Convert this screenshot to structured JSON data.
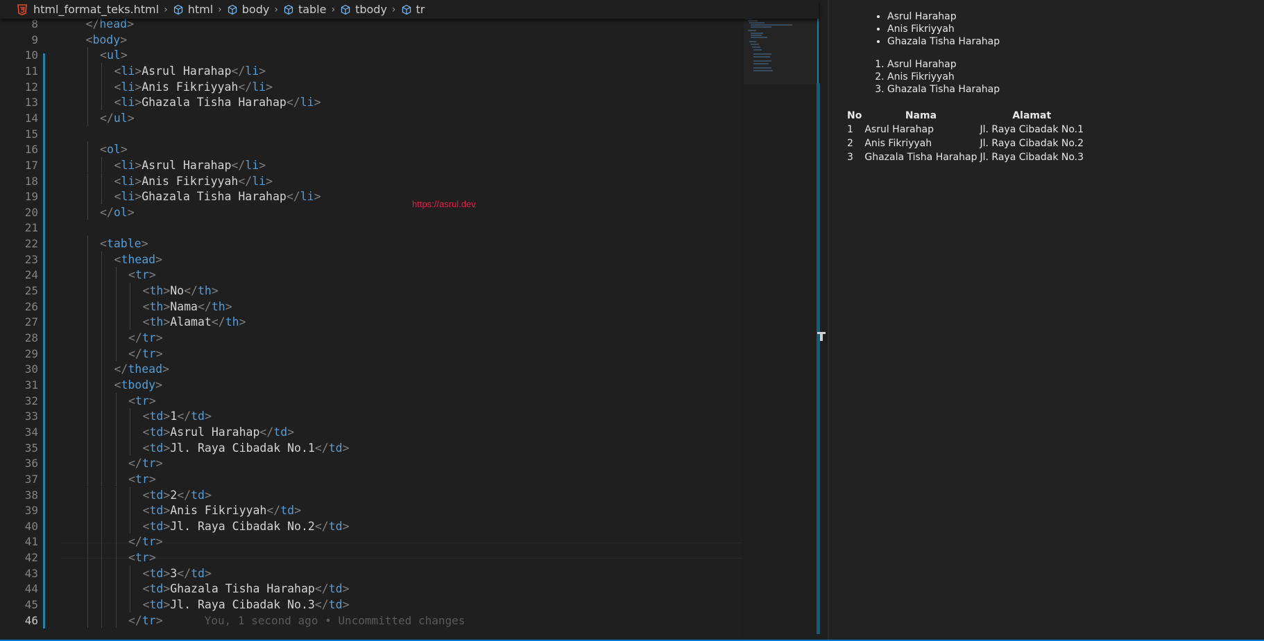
{
  "breadcrumb": {
    "file": "html_format_teks.html",
    "path": [
      "html",
      "body",
      "table",
      "tbody",
      "tr"
    ]
  },
  "editor": {
    "current_line": "46",
    "blame": "You, 1 second ago • Uncommitted changes",
    "lines": [
      {
        "n": "8",
        "indent": 1,
        "parts": [
          [
            "br",
            "</"
          ],
          [
            "tg",
            "head"
          ],
          [
            "br",
            ">"
          ]
        ]
      },
      {
        "n": "9",
        "indent": 1,
        "parts": [
          [
            "br",
            "<"
          ],
          [
            "tg",
            "body"
          ],
          [
            "br",
            ">"
          ]
        ]
      },
      {
        "n": "10",
        "indent": 2,
        "parts": [
          [
            "br",
            "<"
          ],
          [
            "tg",
            "ul"
          ],
          [
            "br",
            ">"
          ]
        ]
      },
      {
        "n": "11",
        "indent": 3,
        "parts": [
          [
            "br",
            "<"
          ],
          [
            "tg",
            "li"
          ],
          [
            "br",
            ">"
          ],
          [
            "tx",
            "Asrul Harahap"
          ],
          [
            "br",
            "</"
          ],
          [
            "tg",
            "li"
          ],
          [
            "br",
            ">"
          ]
        ]
      },
      {
        "n": "12",
        "indent": 3,
        "parts": [
          [
            "br",
            "<"
          ],
          [
            "tg",
            "li"
          ],
          [
            "br",
            ">"
          ],
          [
            "tx",
            "Anis Fikriyyah"
          ],
          [
            "br",
            "</"
          ],
          [
            "tg",
            "li"
          ],
          [
            "br",
            ">"
          ]
        ]
      },
      {
        "n": "13",
        "indent": 3,
        "parts": [
          [
            "br",
            "<"
          ],
          [
            "tg",
            "li"
          ],
          [
            "br",
            ">"
          ],
          [
            "tx",
            "Ghazala Tisha Harahap"
          ],
          [
            "br",
            "</"
          ],
          [
            "tg",
            "li"
          ],
          [
            "br",
            ">"
          ]
        ]
      },
      {
        "n": "14",
        "indent": 2,
        "parts": [
          [
            "br",
            "</"
          ],
          [
            "tg",
            "ul"
          ],
          [
            "br",
            ">"
          ]
        ]
      },
      {
        "n": "15",
        "indent": 0,
        "parts": []
      },
      {
        "n": "16",
        "indent": 2,
        "parts": [
          [
            "br",
            "<"
          ],
          [
            "tg",
            "ol"
          ],
          [
            "br",
            ">"
          ]
        ]
      },
      {
        "n": "17",
        "indent": 3,
        "parts": [
          [
            "br",
            "<"
          ],
          [
            "tg",
            "li"
          ],
          [
            "br",
            ">"
          ],
          [
            "tx",
            "Asrul Harahap"
          ],
          [
            "br",
            "</"
          ],
          [
            "tg",
            "li"
          ],
          [
            "br",
            ">"
          ]
        ]
      },
      {
        "n": "18",
        "indent": 3,
        "parts": [
          [
            "br",
            "<"
          ],
          [
            "tg",
            "li"
          ],
          [
            "br",
            ">"
          ],
          [
            "tx",
            "Anis Fikriyyah"
          ],
          [
            "br",
            "</"
          ],
          [
            "tg",
            "li"
          ],
          [
            "br",
            ">"
          ]
        ]
      },
      {
        "n": "19",
        "indent": 3,
        "parts": [
          [
            "br",
            "<"
          ],
          [
            "tg",
            "li"
          ],
          [
            "br",
            ">"
          ],
          [
            "tx",
            "Ghazala Tisha Harahap"
          ],
          [
            "br",
            "</"
          ],
          [
            "tg",
            "li"
          ],
          [
            "br",
            ">"
          ]
        ]
      },
      {
        "n": "20",
        "indent": 2,
        "parts": [
          [
            "br",
            "</"
          ],
          [
            "tg",
            "ol"
          ],
          [
            "br",
            ">"
          ]
        ]
      },
      {
        "n": "21",
        "indent": 0,
        "parts": []
      },
      {
        "n": "22",
        "indent": 2,
        "parts": [
          [
            "br",
            "<"
          ],
          [
            "tg",
            "table"
          ],
          [
            "br",
            ">"
          ]
        ]
      },
      {
        "n": "23",
        "indent": 3,
        "parts": [
          [
            "br",
            "<"
          ],
          [
            "tg",
            "thead"
          ],
          [
            "br",
            ">"
          ]
        ]
      },
      {
        "n": "24",
        "indent": 4,
        "parts": [
          [
            "br",
            "<"
          ],
          [
            "tg",
            "tr"
          ],
          [
            "br",
            ">"
          ]
        ]
      },
      {
        "n": "25",
        "indent": 5,
        "parts": [
          [
            "br",
            "<"
          ],
          [
            "tg",
            "th"
          ],
          [
            "br",
            ">"
          ],
          [
            "tx",
            "No"
          ],
          [
            "br",
            "</"
          ],
          [
            "tg",
            "th"
          ],
          [
            "br",
            ">"
          ]
        ]
      },
      {
        "n": "26",
        "indent": 5,
        "parts": [
          [
            "br",
            "<"
          ],
          [
            "tg",
            "th"
          ],
          [
            "br",
            ">"
          ],
          [
            "tx",
            "Nama"
          ],
          [
            "br",
            "</"
          ],
          [
            "tg",
            "th"
          ],
          [
            "br",
            ">"
          ]
        ]
      },
      {
        "n": "27",
        "indent": 5,
        "parts": [
          [
            "br",
            "<"
          ],
          [
            "tg",
            "th"
          ],
          [
            "br",
            ">"
          ],
          [
            "tx",
            "Alamat"
          ],
          [
            "br",
            "</"
          ],
          [
            "tg",
            "th"
          ],
          [
            "br",
            ">"
          ]
        ]
      },
      {
        "n": "28",
        "indent": 4,
        "parts": [
          [
            "br",
            "</"
          ],
          [
            "tg",
            "tr"
          ],
          [
            "br",
            ">"
          ]
        ]
      },
      {
        "n": "29",
        "indent": 4,
        "parts": [
          [
            "br",
            "</"
          ],
          [
            "tg",
            "tr"
          ],
          [
            "br",
            ">"
          ]
        ]
      },
      {
        "n": "30",
        "indent": 3,
        "parts": [
          [
            "br",
            "</"
          ],
          [
            "tg",
            "thead"
          ],
          [
            "br",
            ">"
          ]
        ]
      },
      {
        "n": "31",
        "indent": 3,
        "parts": [
          [
            "br",
            "<"
          ],
          [
            "tg",
            "tbody"
          ],
          [
            "br",
            ">"
          ]
        ]
      },
      {
        "n": "32",
        "indent": 4,
        "parts": [
          [
            "br",
            "<"
          ],
          [
            "tg",
            "tr"
          ],
          [
            "br",
            ">"
          ]
        ]
      },
      {
        "n": "33",
        "indent": 5,
        "parts": [
          [
            "br",
            "<"
          ],
          [
            "tg",
            "td"
          ],
          [
            "br",
            ">"
          ],
          [
            "tx",
            "1"
          ],
          [
            "br",
            "</"
          ],
          [
            "tg",
            "td"
          ],
          [
            "br",
            ">"
          ]
        ]
      },
      {
        "n": "34",
        "indent": 5,
        "parts": [
          [
            "br",
            "<"
          ],
          [
            "tg",
            "td"
          ],
          [
            "br",
            ">"
          ],
          [
            "tx",
            "Asrul Harahap"
          ],
          [
            "br",
            "</"
          ],
          [
            "tg",
            "td"
          ],
          [
            "br",
            ">"
          ]
        ]
      },
      {
        "n": "35",
        "indent": 5,
        "parts": [
          [
            "br",
            "<"
          ],
          [
            "tg",
            "td"
          ],
          [
            "br",
            ">"
          ],
          [
            "tx",
            "Jl. Raya Cibadak No.1"
          ],
          [
            "br",
            "</"
          ],
          [
            "tg",
            "td"
          ],
          [
            "br",
            ">"
          ]
        ]
      },
      {
        "n": "36",
        "indent": 4,
        "parts": [
          [
            "br",
            "</"
          ],
          [
            "tg",
            "tr"
          ],
          [
            "br",
            ">"
          ]
        ]
      },
      {
        "n": "37",
        "indent": 4,
        "parts": [
          [
            "br",
            "<"
          ],
          [
            "tg",
            "tr"
          ],
          [
            "br",
            ">"
          ]
        ]
      },
      {
        "n": "38",
        "indent": 5,
        "parts": [
          [
            "br",
            "<"
          ],
          [
            "tg",
            "td"
          ],
          [
            "br",
            ">"
          ],
          [
            "tx",
            "2"
          ],
          [
            "br",
            "</"
          ],
          [
            "tg",
            "td"
          ],
          [
            "br",
            ">"
          ]
        ]
      },
      {
        "n": "39",
        "indent": 5,
        "parts": [
          [
            "br",
            "<"
          ],
          [
            "tg",
            "td"
          ],
          [
            "br",
            ">"
          ],
          [
            "tx",
            "Anis Fikriyyah"
          ],
          [
            "br",
            "</"
          ],
          [
            "tg",
            "td"
          ],
          [
            "br",
            ">"
          ]
        ]
      },
      {
        "n": "40",
        "indent": 5,
        "parts": [
          [
            "br",
            "<"
          ],
          [
            "tg",
            "td"
          ],
          [
            "br",
            ">"
          ],
          [
            "tx",
            "Jl. Raya Cibadak No.2"
          ],
          [
            "br",
            "</"
          ],
          [
            "tg",
            "td"
          ],
          [
            "br",
            ">"
          ]
        ]
      },
      {
        "n": "41",
        "indent": 4,
        "parts": [
          [
            "br",
            "</"
          ],
          [
            "tg",
            "tr"
          ],
          [
            "br",
            ">"
          ]
        ]
      },
      {
        "n": "42",
        "indent": 4,
        "parts": [
          [
            "br",
            "<"
          ],
          [
            "tg",
            "tr"
          ],
          [
            "br",
            ">"
          ]
        ]
      },
      {
        "n": "43",
        "indent": 5,
        "parts": [
          [
            "br",
            "<"
          ],
          [
            "tg",
            "td"
          ],
          [
            "br",
            ">"
          ],
          [
            "tx",
            "3"
          ],
          [
            "br",
            "</"
          ],
          [
            "tg",
            "td"
          ],
          [
            "br",
            ">"
          ]
        ]
      },
      {
        "n": "44",
        "indent": 5,
        "parts": [
          [
            "br",
            "<"
          ],
          [
            "tg",
            "td"
          ],
          [
            "br",
            ">"
          ],
          [
            "tx",
            "Ghazala Tisha Harahap"
          ],
          [
            "br",
            "</"
          ],
          [
            "tg",
            "td"
          ],
          [
            "br",
            ">"
          ]
        ]
      },
      {
        "n": "45",
        "indent": 5,
        "parts": [
          [
            "br",
            "<"
          ],
          [
            "tg",
            "td"
          ],
          [
            "br",
            ">"
          ],
          [
            "tx",
            "Jl. Raya Cibadak No.3"
          ],
          [
            "br",
            "</"
          ],
          [
            "tg",
            "td"
          ],
          [
            "br",
            ">"
          ]
        ]
      },
      {
        "n": "46",
        "indent": 4,
        "parts": [
          [
            "br",
            "</"
          ],
          [
            "tg",
            "tr"
          ],
          [
            "br",
            ">"
          ]
        ]
      }
    ]
  },
  "watermark": "https://asrul.dev",
  "preview": {
    "ul": [
      "Asrul Harahap",
      "Anis Fikriyyah",
      "Ghazala Tisha Harahap"
    ],
    "ol": [
      "Asrul Harahap",
      "Anis Fikriyyah",
      "Ghazala Tisha Harahap"
    ],
    "table": {
      "headers": [
        "No",
        "Nama",
        "Alamat"
      ],
      "rows": [
        [
          "1",
          "Asrul Harahap",
          "Jl. Raya Cibadak No.1"
        ],
        [
          "2",
          "Anis Fikriyyah",
          "Jl. Raya Cibadak No.2"
        ],
        [
          "3",
          "Ghazala Tisha Harahap",
          "Jl. Raya Cibadak No.3"
        ]
      ]
    }
  },
  "colors": {
    "tag": "#569cd6",
    "bracket": "#808080",
    "text": "#d4d4d4",
    "accent": "#007acc",
    "watermark": "#e51f4a"
  }
}
